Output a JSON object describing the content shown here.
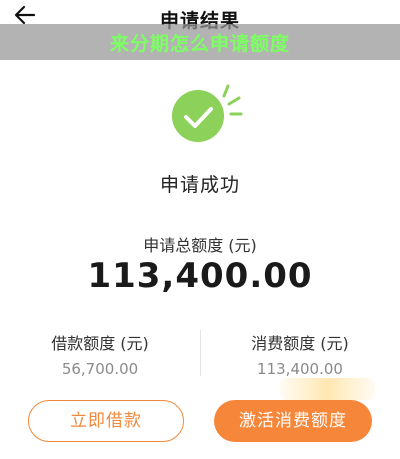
{
  "nav": {
    "back_icon": "arrow-left-icon",
    "title": "申请结果"
  },
  "banner": {
    "text": "来分期怎么申请额度"
  },
  "result": {
    "icon": "check-circle-icon",
    "status": "申请成功",
    "total_label": "申请总额度 (元)",
    "total_amount": "113,400.00"
  },
  "breakdown": {
    "loan_label": "借款额度 (元)",
    "loan_value": "56,700.00",
    "consumer_label": "消费额度 (元)",
    "consumer_value": "113,400.00"
  },
  "actions": {
    "borrow_label": "立即借款",
    "activate_label": "激活消费额度"
  },
  "colors": {
    "accent": "#f6873a",
    "success": "#8bd15a",
    "banner_text": "#7dff63"
  }
}
